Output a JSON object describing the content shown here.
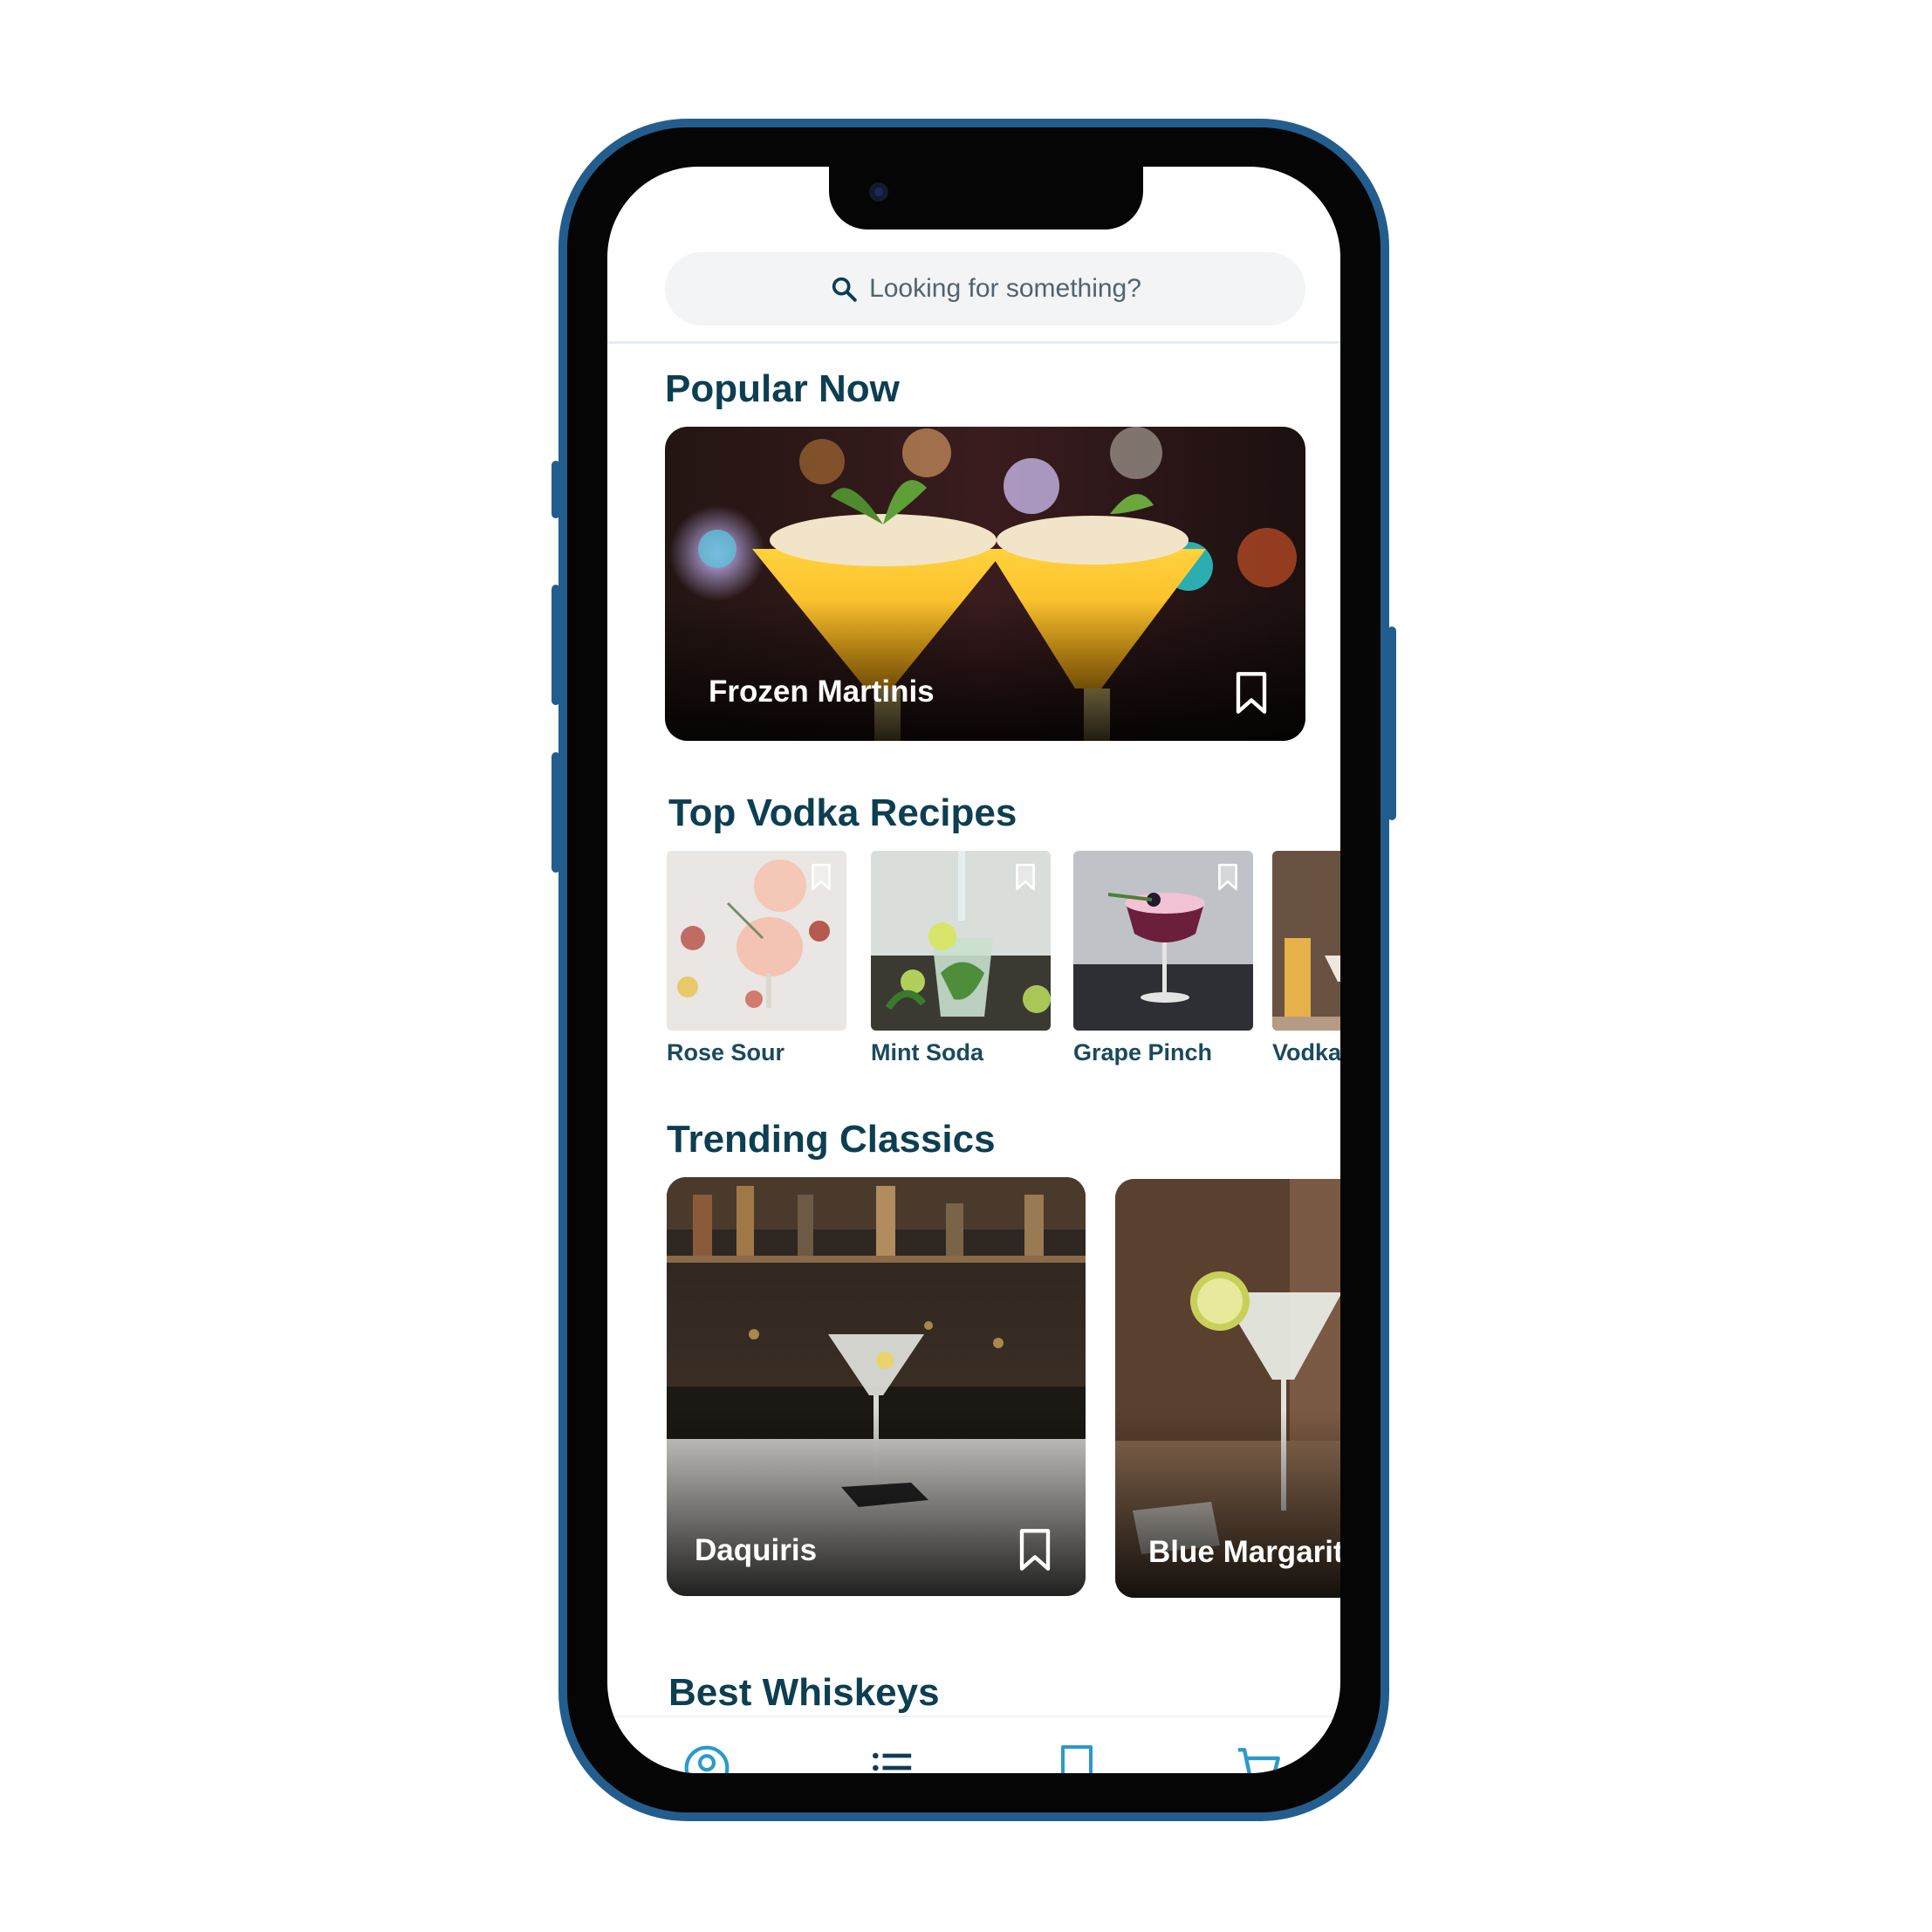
{
  "search": {
    "placeholder": "Looking for something?",
    "icon": "search-icon"
  },
  "sections": {
    "popular": {
      "title": "Popular Now",
      "card": {
        "label": "Frozen Martinis",
        "icon": "bookmark-icon"
      }
    },
    "vodka": {
      "title": "Top Vodka Recipes",
      "items": [
        {
          "label": "Rose Sour"
        },
        {
          "label": "Mint Soda"
        },
        {
          "label": "Grape Pinch"
        },
        {
          "label": "Vodka T"
        }
      ]
    },
    "classics": {
      "title": "Trending Classics",
      "cards": [
        {
          "label": "Daquiris"
        },
        {
          "label": "Blue Margarita"
        }
      ]
    },
    "whiskeys": {
      "title": "Best Whiskeys"
    }
  },
  "nav": {
    "items": [
      "profile-icon",
      "list-icon",
      "bookmark-icon",
      "cart-icon"
    ],
    "accent": "#2b9ac9"
  },
  "colors": {
    "heading": "#0d3e52",
    "frame": "#235d8d"
  }
}
